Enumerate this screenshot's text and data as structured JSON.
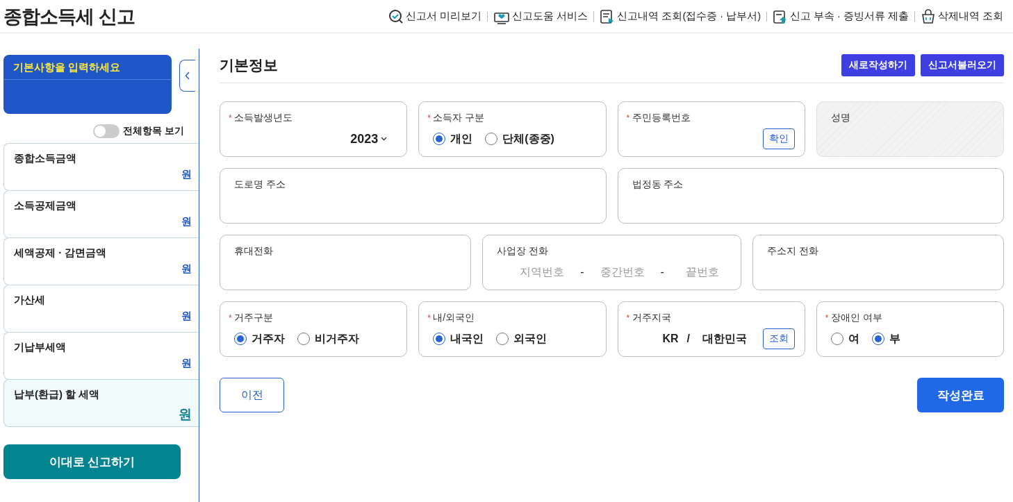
{
  "header": {
    "title": "종합소득세 신고",
    "links": [
      {
        "label": "신고서 미리보기"
      },
      {
        "label": "신고도움 서비스"
      },
      {
        "label": "신고내역 조회(접수증 · 납부서)"
      },
      {
        "label": "신고 부속 · 증빙서류 제출"
      },
      {
        "label": "삭제내역 조회"
      }
    ]
  },
  "sidebar": {
    "banner": {
      "title": "기본사항을 입력하세요"
    },
    "toggle": {
      "label": "전체항목 보기",
      "on": false
    },
    "items": [
      {
        "label": "종합소득금액",
        "unit": "원",
        "kind": "amount"
      },
      {
        "label": "소득공제금액",
        "unit": "원",
        "kind": "amount"
      },
      {
        "label": "세액공제 · 감면금액",
        "unit": "원",
        "kind": "amount"
      },
      {
        "label": "가산세",
        "unit": "원",
        "kind": "amount"
      },
      {
        "label": "기납부세액",
        "unit": "원",
        "kind": "amount"
      },
      {
        "label": "납부(환급) 할 세액",
        "unit": "원",
        "kind": "total"
      }
    ],
    "submit": "이대로 신고하기"
  },
  "main": {
    "title": "기본정보",
    "buttons": [
      "새로작성하기",
      "신고서불러오기"
    ],
    "rows": [
      [
        {
          "kind": "select",
          "required_mark": "*",
          "label": "소득발생년도",
          "value": "2023"
        },
        {
          "kind": "radio",
          "required_mark": "*",
          "label": "소득자 구분",
          "options": [
            {
              "label": "개인",
              "selected": true
            },
            {
              "label": "단체(종중)",
              "selected": false
            }
          ]
        },
        {
          "kind": "button",
          "required_mark": "*",
          "label": "주민등록번호",
          "button": "확인"
        },
        {
          "kind": "disabled",
          "label": "성명"
        }
      ],
      [
        {
          "kind": "text",
          "label": "도로명 주소"
        },
        {
          "kind": "text",
          "label": "법정동 주소"
        }
      ],
      [
        {
          "kind": "text",
          "label": "휴대전화"
        },
        {
          "kind": "phone",
          "label": "사업장 전화",
          "placeholders": [
            "지역번호",
            "중간번호",
            "끝번호"
          ],
          "separator": "-"
        },
        {
          "kind": "text",
          "label": "주소지 전화"
        }
      ],
      [
        {
          "kind": "radio",
          "required_mark": "*",
          "label": "거주구분",
          "options": [
            {
              "label": "거주자",
              "selected": true
            },
            {
              "label": "비거주자",
              "selected": false
            }
          ]
        },
        {
          "kind": "radio",
          "required_mark": "*",
          "label": "내/외국인",
          "options": [
            {
              "label": "내국인",
              "selected": true
            },
            {
              "label": "외국인",
              "selected": false
            }
          ]
        },
        {
          "kind": "lookup",
          "required_mark": "*",
          "label": "거주지국",
          "code": "KR",
          "separator": "/",
          "country": "대한민국",
          "button": "조회"
        },
        {
          "kind": "radio",
          "required_mark": "*",
          "label": "장애인 여부",
          "options": [
            {
              "label": "여",
              "selected": false
            },
            {
              "label": "부",
              "selected": true
            }
          ]
        }
      ]
    ],
    "prev": "이전",
    "complete": "작성완료"
  }
}
